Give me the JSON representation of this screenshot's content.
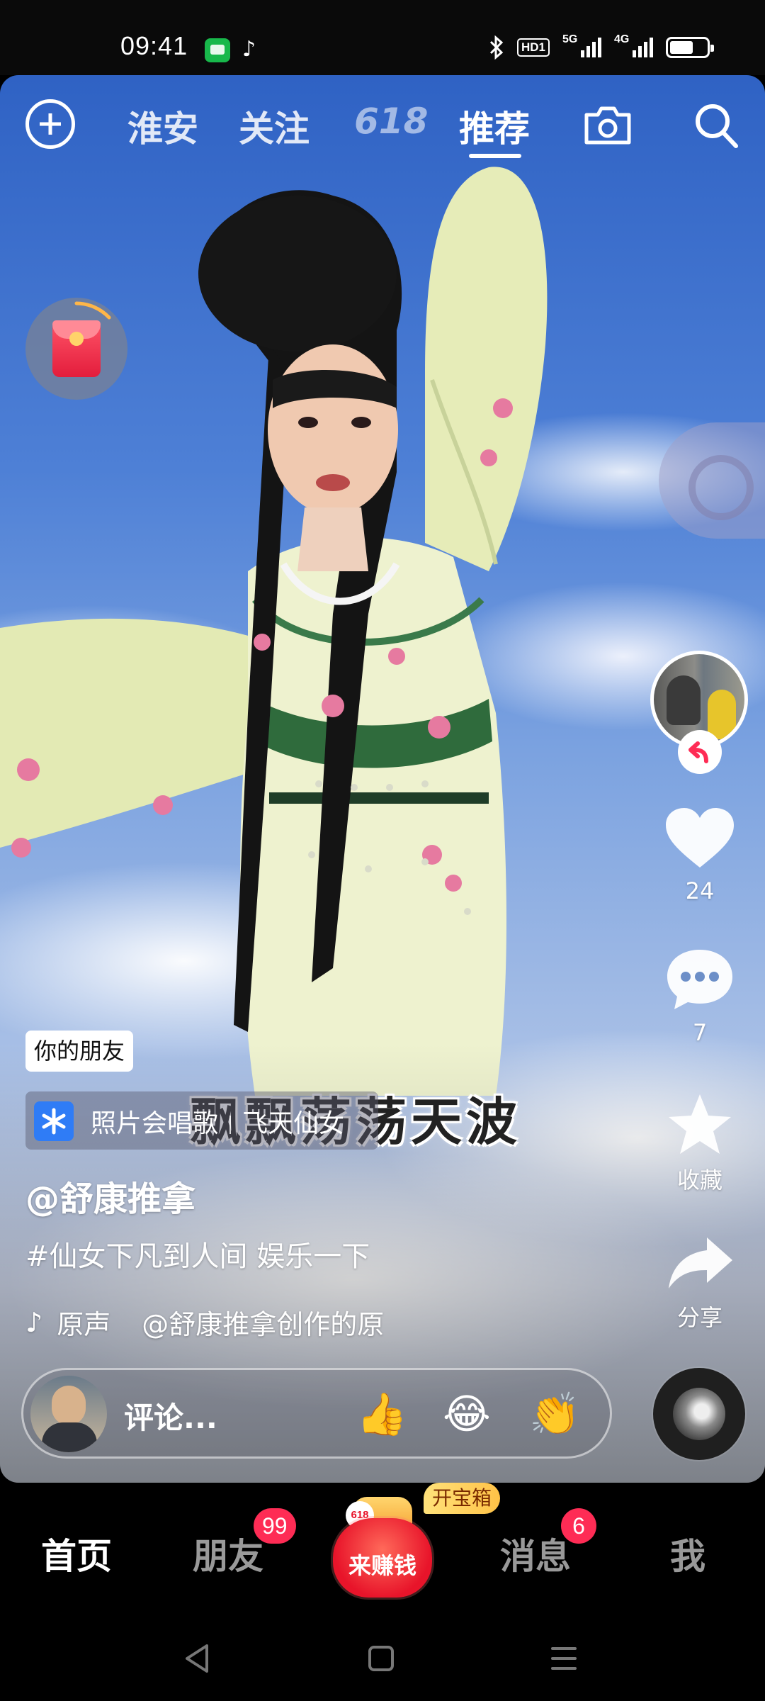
{
  "status_bar": {
    "time": "09:41",
    "app_icons": [
      "messages-icon",
      "tiktok-icon"
    ],
    "tiktok_glyph": "♪",
    "hd_label": "HD1",
    "signal_1": "5G",
    "signal_2": "4G"
  },
  "top_nav": {
    "tabs": [
      "淮安",
      "关注",
      "618",
      "推荐"
    ],
    "active_tab": "推荐"
  },
  "video": {
    "subtitle": "飘飘荡荡天波",
    "friend_tag": "你的朋友",
    "effect": {
      "name": "照片会唱歌",
      "template": "飞天仙女"
    },
    "author": "@舒康推拿",
    "description": "#仙女下凡到人间 娱乐一下",
    "music": {
      "label": "原声",
      "track": "@舒康推拿创作的原"
    }
  },
  "right_rail": {
    "likes": "24",
    "comments": "7",
    "favorite_label": "收藏",
    "share_label": "分享"
  },
  "comment_bar": {
    "placeholder": "评论...",
    "emojis": [
      "👍",
      "😂",
      "👏"
    ]
  },
  "tab_bar": {
    "tabs": [
      {
        "label": "首页",
        "badge": ""
      },
      {
        "label": "朋友",
        "badge": "99"
      },
      {
        "label": "来赚钱",
        "badge": ""
      },
      {
        "label": "消息",
        "badge": "6"
      },
      {
        "label": "我",
        "badge": ""
      }
    ],
    "treasure_label": "开宝箱",
    "earn_tag": "618",
    "active_tab": "首页"
  },
  "colors": {
    "accent_red": "#fe2c55",
    "sky_top": "#2f62c4",
    "effect_blue": "#2f7cf6"
  }
}
